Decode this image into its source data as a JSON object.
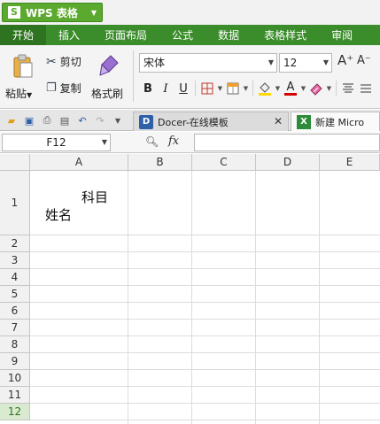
{
  "app": {
    "title": "WPS 表格",
    "logo_glyph": "S",
    "accent_color": "#5ba92e",
    "menu_color": "#3a8d2a"
  },
  "menu": {
    "tabs": [
      "开始",
      "插入",
      "页面布局",
      "公式",
      "数据",
      "表格样式",
      "审阅"
    ],
    "active": "开始"
  },
  "ribbon": {
    "paste_label": "粘贴",
    "cut_label": "剪切",
    "copy_label": "复制",
    "format_painter_label": "格式刷",
    "font_name": "宋体",
    "font_size": "12",
    "bold_label": "B",
    "italic_label": "I",
    "underline_label": "U",
    "grow_font_label": "A⁺",
    "shrink_font_label": "A⁻",
    "font_color_label": "A",
    "fill_color": "#ffd800",
    "font_color": "#d40000"
  },
  "tabs_bar": {
    "doc_tabs": [
      {
        "label": "Docer-在线模板",
        "icon": "D"
      },
      {
        "label": "新建 Micro",
        "icon": "X"
      }
    ]
  },
  "formula_bar": {
    "cell_ref": "F12",
    "fx_label": "fx",
    "formula_value": ""
  },
  "grid": {
    "columns": [
      "A",
      "B",
      "C",
      "D",
      "E"
    ],
    "rows": [
      "1",
      "2",
      "3",
      "4",
      "5",
      "6",
      "7",
      "8",
      "9",
      "10",
      "11",
      "12"
    ],
    "selected_row": "12",
    "cell_a1_top": "科目",
    "cell_a1_bottom": "姓名"
  }
}
